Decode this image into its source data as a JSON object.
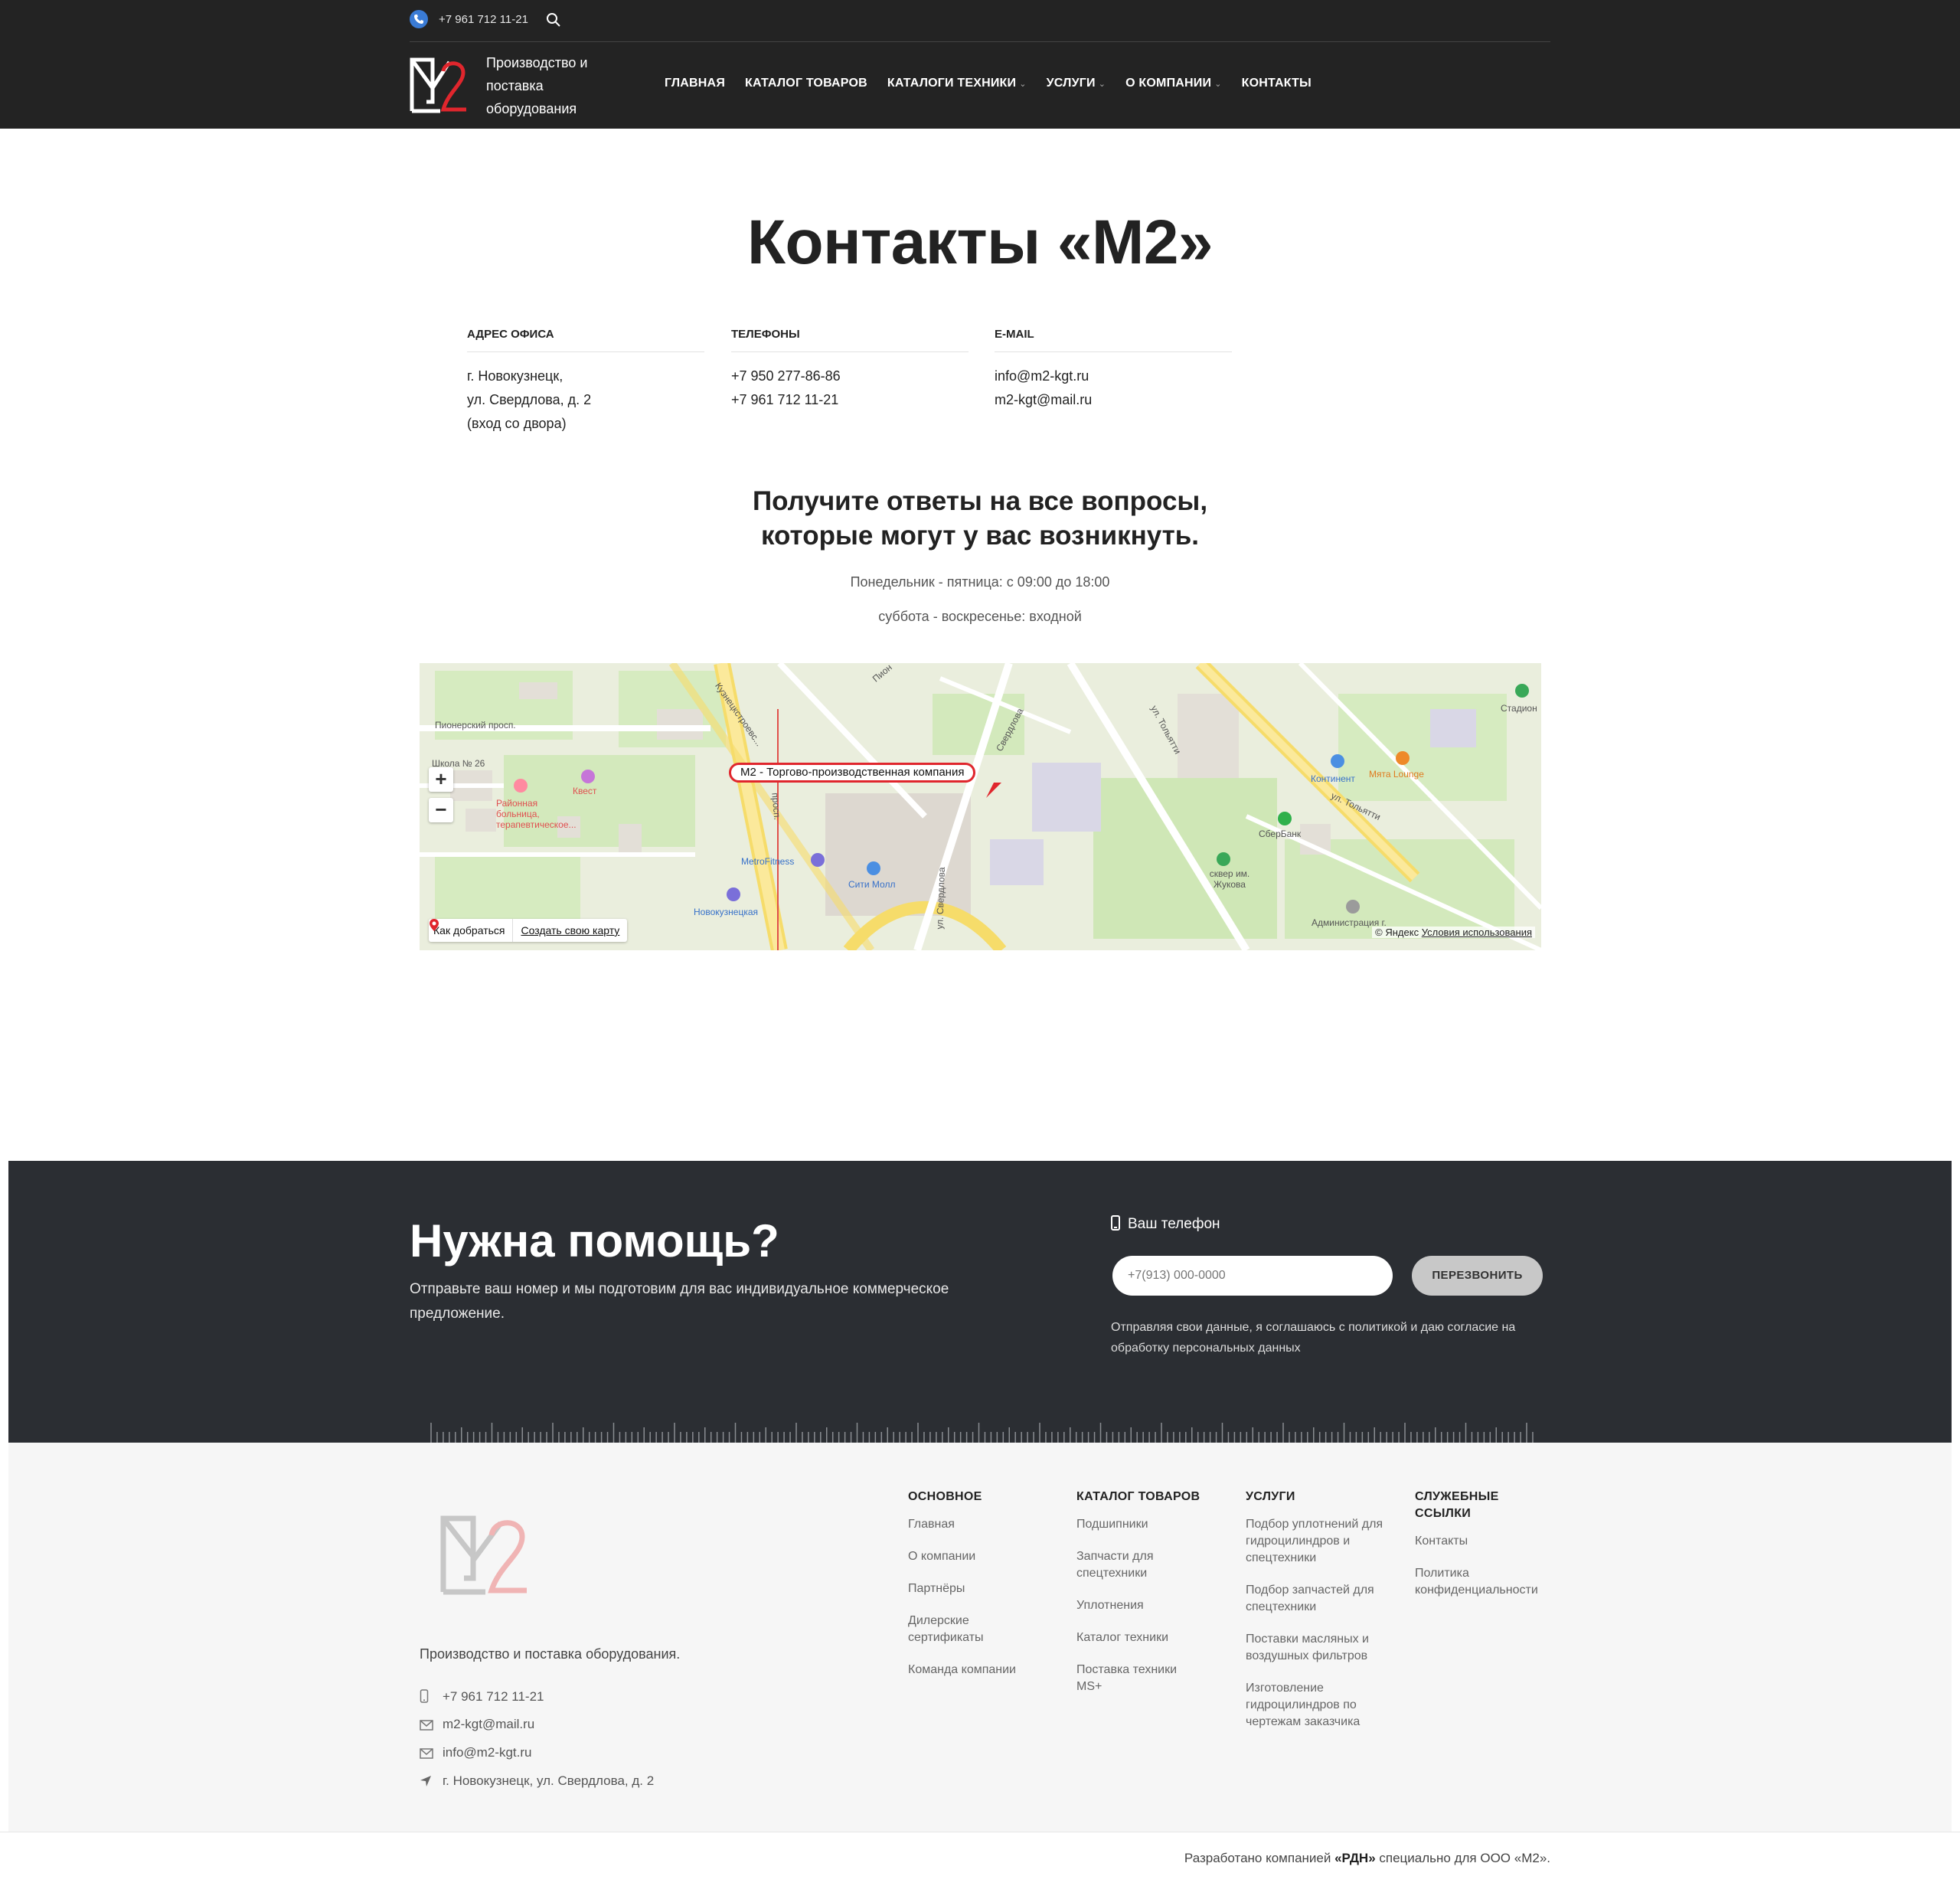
{
  "header": {
    "top_phone": "+7 961 712 11-21",
    "logo_text": [
      "Производство и",
      "поставка",
      "оборудования"
    ],
    "nav": [
      {
        "label": "ГЛАВНАЯ",
        "dropdown": false
      },
      {
        "label": "КАТАЛОГ ТОВАРОВ",
        "dropdown": false
      },
      {
        "label": "КАТАЛОГИ ТЕХНИКИ",
        "dropdown": true
      },
      {
        "label": "УСЛУГИ",
        "dropdown": true
      },
      {
        "label": "О КОМПАНИИ",
        "dropdown": true
      },
      {
        "label": "КОНТАКТЫ",
        "dropdown": false
      }
    ]
  },
  "page": {
    "title": "Контакты «М2»",
    "columns": [
      {
        "caption": "АДРЕС ОФИСА",
        "lines": [
          "г. Новокузнецк,",
          "ул. Свердлова, д. 2",
          "(вход со двора)"
        ]
      },
      {
        "caption": "ТЕЛЕФОНЫ",
        "lines": [
          "+7 950 277-86-86",
          "+7 961 712 11-21"
        ]
      },
      {
        "caption": "E-MAIL",
        "lines": [
          "info@m2-kgt.ru",
          "m2-kgt@mail.ru"
        ]
      }
    ],
    "faq_title_line1": "Получите ответы на все вопросы,",
    "faq_title_line2": "которые могут у вас возникнуть.",
    "hours_weekdays": "Понедельник - пятница: с 09:00 до 18:00",
    "hours_weekend": "суббота - воскресенье: входной"
  },
  "map": {
    "placemark": "М2 - Торгово-производственная компания",
    "zoom_in": "+",
    "zoom_out": "−",
    "route": "Как добраться",
    "create": "Создать свою карту",
    "copyright": "© Яндекс",
    "terms": "Условия использования",
    "labels": {
      "pioneer": "Пионерский просп.",
      "school": "Школа № 26",
      "hospital": "Районная больница, терапевтическое...",
      "quest": "Квест",
      "kuznetsk": "Кузнецкстроевс...",
      "prosp": "просп.",
      "metrofitness": "MetroFitness",
      "city_mall": "Сити Молл",
      "novokuznetskaya": "Новокузнецкая",
      "sverdlova": "ул. Свердлова",
      "sverdlova2": "Свердлова",
      "tolyatti1": "ул. Тольятти",
      "tolyatti2": "ул. Тольятти",
      "kontinent": "Континент",
      "myata": "Мята Lounge",
      "sberbank": "СберБанк",
      "square": "сквер им. Жукова",
      "admin": "Администрация г.",
      "stadium": "Стадион",
      "pio": "Пион"
    }
  },
  "help": {
    "title": "Нужна помощь?",
    "subtitle": "Отправьте ваш номер и мы подготовим для вас индивидуальное коммерческое предложение.",
    "phone_label": "Ваш телефон",
    "phone_placeholder": "+7(913) 000-0000",
    "button": "ПЕРЕЗВОНИТЬ",
    "consent": "Отправляя свои данные, я соглашаюсь с политикой и даю согласие на обработку персональных данных"
  },
  "footer": {
    "description": "Производство и поставка оборудования.",
    "phone": "+7 961 712 11-21",
    "email1": "m2-kgt@mail.ru",
    "email2": "info@m2-kgt.ru",
    "address": "г. Новокузнецк, ул. Свердлова, д. 2",
    "columns": [
      {
        "heading": "ОСНОВНОЕ",
        "links": [
          "Главная",
          "О компании",
          "Партнёры",
          "Дилерские сертификаты",
          "Команда компании"
        ]
      },
      {
        "heading": "КАТАЛОГ ТОВАРОВ",
        "links": [
          "Подшипники",
          "Запчасти для спецтехники",
          "Уплотнения",
          "Каталог техники",
          "Поставка техники MS+"
        ]
      },
      {
        "heading": "УСЛУГИ",
        "links": [
          "Подбор уплотнений для гидроцилиндров и спецтехники",
          "Подбор запчастей для спецтехники",
          "Поставки масляных и воздушных фильтров",
          "Изготовление гидроцилиндров по чертежам заказчика"
        ]
      },
      {
        "heading": "СЛУЖЕБНЫЕ ССЫЛКИ",
        "links": [
          "Контакты",
          "Политика конфиденциальности"
        ]
      }
    ],
    "credit_prefix": "Разработано компанией ",
    "credit_company": "«РДН»",
    "credit_suffix": " специально для ООО «М2»."
  },
  "colors": {
    "header_bg": "#232323",
    "accent_red": "#e0262d",
    "help_bg": "#2b2e33",
    "footer_bg": "#f6f6f6",
    "phone_icon": "#3a7bd5"
  }
}
